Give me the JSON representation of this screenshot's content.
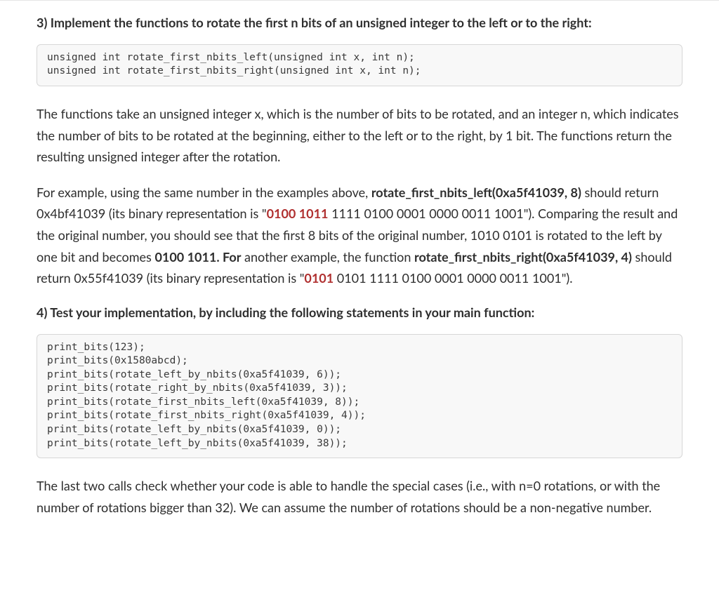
{
  "section3": {
    "heading": "3) Implement the functions to rotate the first n bits of an unsigned integer to the left or to the right:",
    "code": "unsigned int rotate_first_nbits_left(unsigned int x, int n);\nunsigned int rotate_first_nbits_right(unsigned int x, int n);",
    "para1": "The functions take an unsigned integer x, which is the number of bits to be rotated, and an integer n, which indicates the number of bits to be rotated at the beginning, either to the left or to the right, by 1 bit. The functions return the resulting unsigned integer after the rotation.",
    "para2": {
      "t0": "For example, using the same number in the examples above, ",
      "bold0": "rotate_first_nbits_left(0xa5f41039, 8)",
      "t1": " should return 0x4bf41039 (its binary representation is \"",
      "hl0": "0100 1011",
      "t2": " 1111 0100 0001 0000  0011 1001\"). Comparing the result and the original number, you should see that the first 8 bits of the original number, 1010 0101 is rotated to the left by one bit and becomes ",
      "bold1": "0100 1011. For",
      "t3": " another example, the function ",
      "bold2": "rotate_first_nbits_right(0xa5f41039, 4)",
      "t4": " should return 0x55f41039 (its binary representation is \"",
      "hl1": "0101",
      "t5": " 0101 1111 0100 0001 0000  0011 1001\")."
    }
  },
  "section4": {
    "heading": "4) Test your implementation, by including the following statements in your main function:",
    "code": "print_bits(123);\nprint_bits(0x1580abcd);\nprint_bits(rotate_left_by_nbits(0xa5f41039, 6));\nprint_bits(rotate_right_by_nbits(0xa5f41039, 3));\nprint_bits(rotate_first_nbits_left(0xa5f41039, 8));\nprint_bits(rotate_first_nbits_right(0xa5f41039, 4));\nprint_bits(rotate_left_by_nbits(0xa5f41039, 0));\nprint_bits(rotate_left_by_nbits(0xa5f41039, 38));",
    "para": "The last two calls check whether your code is able to handle the special cases (i.e., with n=0 rotations, or with the number of rotations bigger than 32). We can assume the number of rotations should be a non-negative number."
  }
}
